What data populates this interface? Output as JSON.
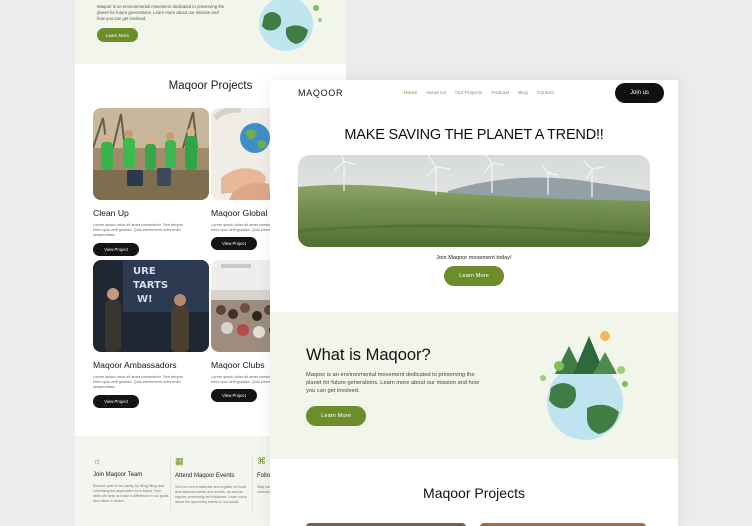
{
  "back_page": {
    "hero": {
      "description": "Maqoor is an environmental movement dedicated to preserving the planet for future generations. Learn more about our mission and how you can get involved.",
      "button": "Learn More"
    },
    "projects_title": "Maqoor Projects",
    "cards": [
      {
        "title": "Clean Up",
        "description": "Lorem ipsum dolor sit amet consectetur. Sed tempor enim quis velit gravida. Quis elementum nulla enim suspendisse.",
        "button": "View Project"
      },
      {
        "title": "Maqoor Global I",
        "description": "Lorem ipsum dolor sit amet consectetur. Sed tempor enim quis velit gravida. Quis elementum nulla",
        "button": "View Project"
      },
      {
        "title": "Maqoor Ambassadors",
        "description": "Lorem ipsum dolor sit amet consectetur. Sed tempor enim quis velit gravida. Quis elementum nulla enim suspendisse.",
        "button": "View Project"
      },
      {
        "title": "Maqoor Clubs",
        "description": "Lorem ipsum dolor sit amet consectetur. Sed tempor enim quis velit gravida. Quis elementum nulla",
        "button": "View Project"
      }
    ],
    "footer": [
      {
        "icon": "sun-icon",
        "title": "Join Maqoor Team",
        "description": "Become part of our family by filling filling and submitting the application form below. Your skills will help us make a difference in our goals and vision in action."
      },
      {
        "icon": "calendar-icon",
        "title": "Attend Maqoor Events",
        "description": "Visit our event calendar and register for local and national events and events, as well as regular community-led initiatives. Learn more about the upcoming events in our social."
      },
      {
        "icon": "share-icon",
        "title": "Follow Socia",
        "description": "Stay connected through our social media channels. Highlighting news"
      }
    ]
  },
  "front_page": {
    "logo": "MAQOOR",
    "nav": [
      "Home",
      "About Us",
      "Our Projects",
      "Podcast",
      "Blog",
      "Contact"
    ],
    "nav_active": "Home",
    "join_button": "Join us",
    "headline": "MAKE SAVING THE PLANET A TREND!!",
    "subtext": "Join Maqoor movement today!",
    "hero_button": "Learn More",
    "about": {
      "title": "What is Maqoor?",
      "description": "Maqoor is an environmental movement dedicated to preserving the planet for future generations. Learn more about our mission and how you can get involved.",
      "button": "Learn More"
    },
    "projects_title": "Maqoor Projects"
  },
  "colors": {
    "brand_green": "#6b8e2b",
    "dark": "#101010",
    "light_green_bg": "#f1f5ea"
  }
}
